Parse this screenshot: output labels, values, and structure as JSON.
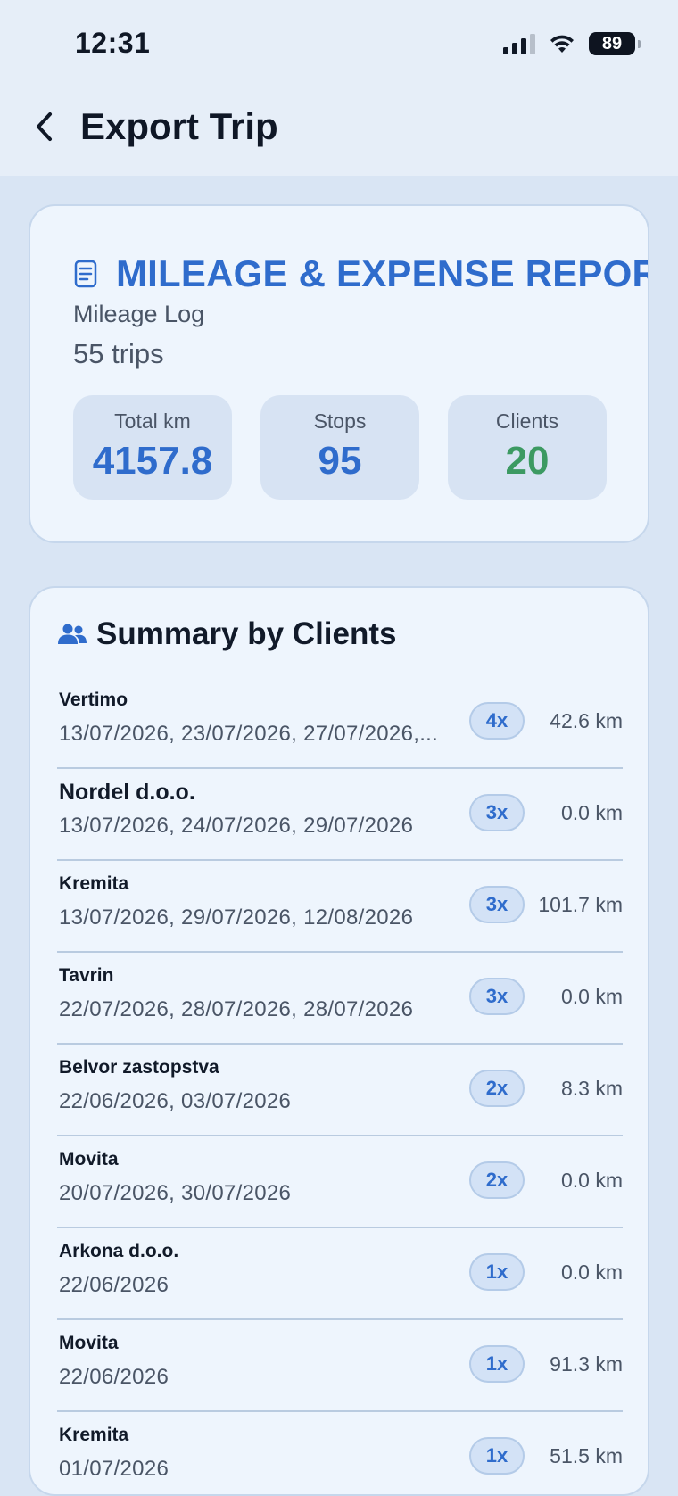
{
  "status_bar": {
    "time": "12:31",
    "battery": "89",
    "icons": [
      "signal-icon",
      "wifi-icon",
      "battery-icon"
    ]
  },
  "nav": {
    "back_icon": "chevron-left-icon",
    "title": "Export Trip"
  },
  "report": {
    "icon": "document-icon",
    "title": "MILEAGE & EXPENSE REPORT",
    "subtitle": "Mileage Log",
    "trips": "55 trips",
    "stats": [
      {
        "label": "Total km",
        "value": "4157.8",
        "color": "#2f6ccc"
      },
      {
        "label": "Stops",
        "value": "95",
        "color": "#2f6ccc"
      },
      {
        "label": "Clients",
        "value": "20",
        "color": "#3c9a62"
      }
    ]
  },
  "summary": {
    "icon": "users-icon",
    "title": "Summary by Clients",
    "clients": [
      {
        "name": "Vertimo",
        "dates": "13/07/2026, 23/07/2026, 27/07/2026,...",
        "count": "4x",
        "km": "42.6 km"
      },
      {
        "name": "Nordel d.o.o.",
        "dates": "13/07/2026, 24/07/2026, 29/07/2026",
        "count": "3x",
        "km": "0.0 km"
      },
      {
        "name": "Kremita",
        "dates": "13/07/2026, 29/07/2026, 12/08/2026",
        "count": "3x",
        "km": "101.7 km"
      },
      {
        "name": "Tavrin",
        "dates": "22/07/2026, 28/07/2026, 28/07/2026",
        "count": "3x",
        "km": "0.0 km"
      },
      {
        "name": "Belvor zastopstva",
        "dates": "22/06/2026, 03/07/2026",
        "count": "2x",
        "km": "8.3 km"
      },
      {
        "name": "Movita",
        "dates": "20/07/2026, 30/07/2026",
        "count": "2x",
        "km": "0.0 km"
      },
      {
        "name": "Arkona d.o.o.",
        "dates": "22/06/2026",
        "count": "1x",
        "km": "0.0 km"
      },
      {
        "name": "Movita",
        "dates": "22/06/2026",
        "count": "1x",
        "km": "91.3 km"
      },
      {
        "name": "Kremita",
        "dates": "01/07/2026",
        "count": "1x",
        "km": "51.5 km"
      }
    ]
  }
}
